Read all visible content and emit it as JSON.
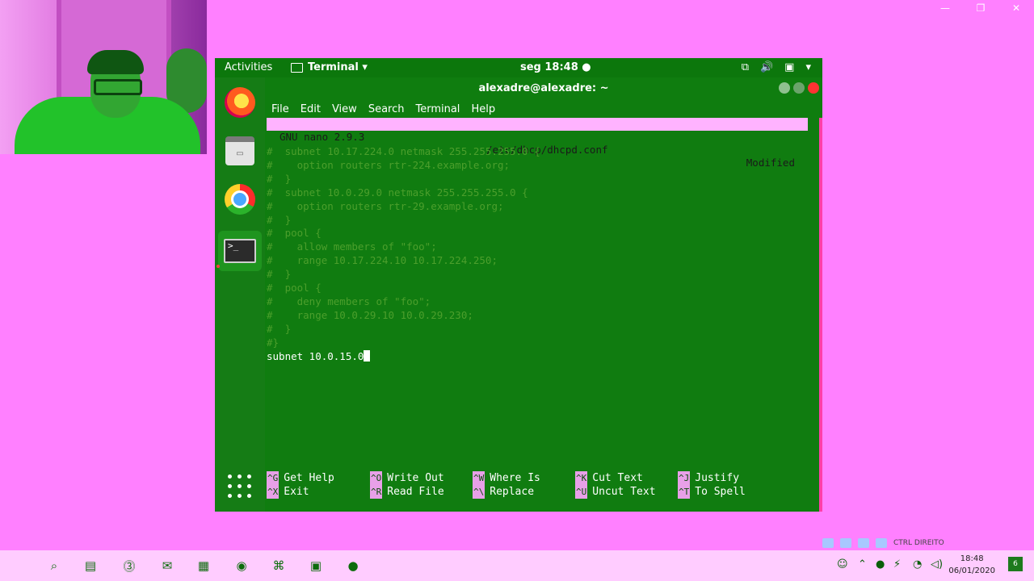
{
  "host_window": {
    "minimize": "—",
    "restore": "❐",
    "close": "✕"
  },
  "ubuntu": {
    "activities": "Activities",
    "app_menu": "Terminal ▾",
    "clock": "seg 18:48 ●",
    "tray": [
      "network-icon",
      "volume-icon",
      "battery-icon",
      "menu-arrow-icon"
    ]
  },
  "terminal_window": {
    "title": "alexadre@alexadre: ~",
    "menu": [
      "File",
      "Edit",
      "View",
      "Search",
      "Terminal",
      "Help"
    ]
  },
  "nano": {
    "version": "GNU nano 2.9.3",
    "file": "/etc/dhcp/dhcpd.conf",
    "status": "Modified",
    "comment_lines": [
      "#  subnet 10.17.224.0 netmask 255.255.255.0 {",
      "#    option routers rtr-224.example.org;",
      "#  }",
      "#  subnet 10.0.29.0 netmask 255.255.255.0 {",
      "#    option routers rtr-29.example.org;",
      "#  }",
      "#  pool {",
      "#    allow members of \"foo\";",
      "#    range 10.17.224.10 10.17.224.250;",
      "#  }",
      "#  pool {",
      "#    deny members of \"foo\";",
      "#    range 10.0.29.10 10.0.29.230;",
      "#  }",
      "#}"
    ],
    "current_line": "subnet 10.0.15.0",
    "shortcuts": [
      {
        "key": "^G",
        "label": "Get Help"
      },
      {
        "key": "^O",
        "label": "Write Out"
      },
      {
        "key": "^W",
        "label": "Where Is"
      },
      {
        "key": "^K",
        "label": "Cut Text"
      },
      {
        "key": "^J",
        "label": "Justify"
      },
      {
        "key": "^X",
        "label": "Exit"
      },
      {
        "key": "^R",
        "label": "Read File"
      },
      {
        "key": "^\\",
        "label": "Replace"
      },
      {
        "key": "^U",
        "label": "Uncut Text"
      },
      {
        "key": "^T",
        "label": "To Spell"
      }
    ]
  },
  "windows_taskbar": {
    "notify_text": "CTRL DIREITO",
    "time": "18:48",
    "date": "06/01/2020",
    "notification_count": "6"
  }
}
